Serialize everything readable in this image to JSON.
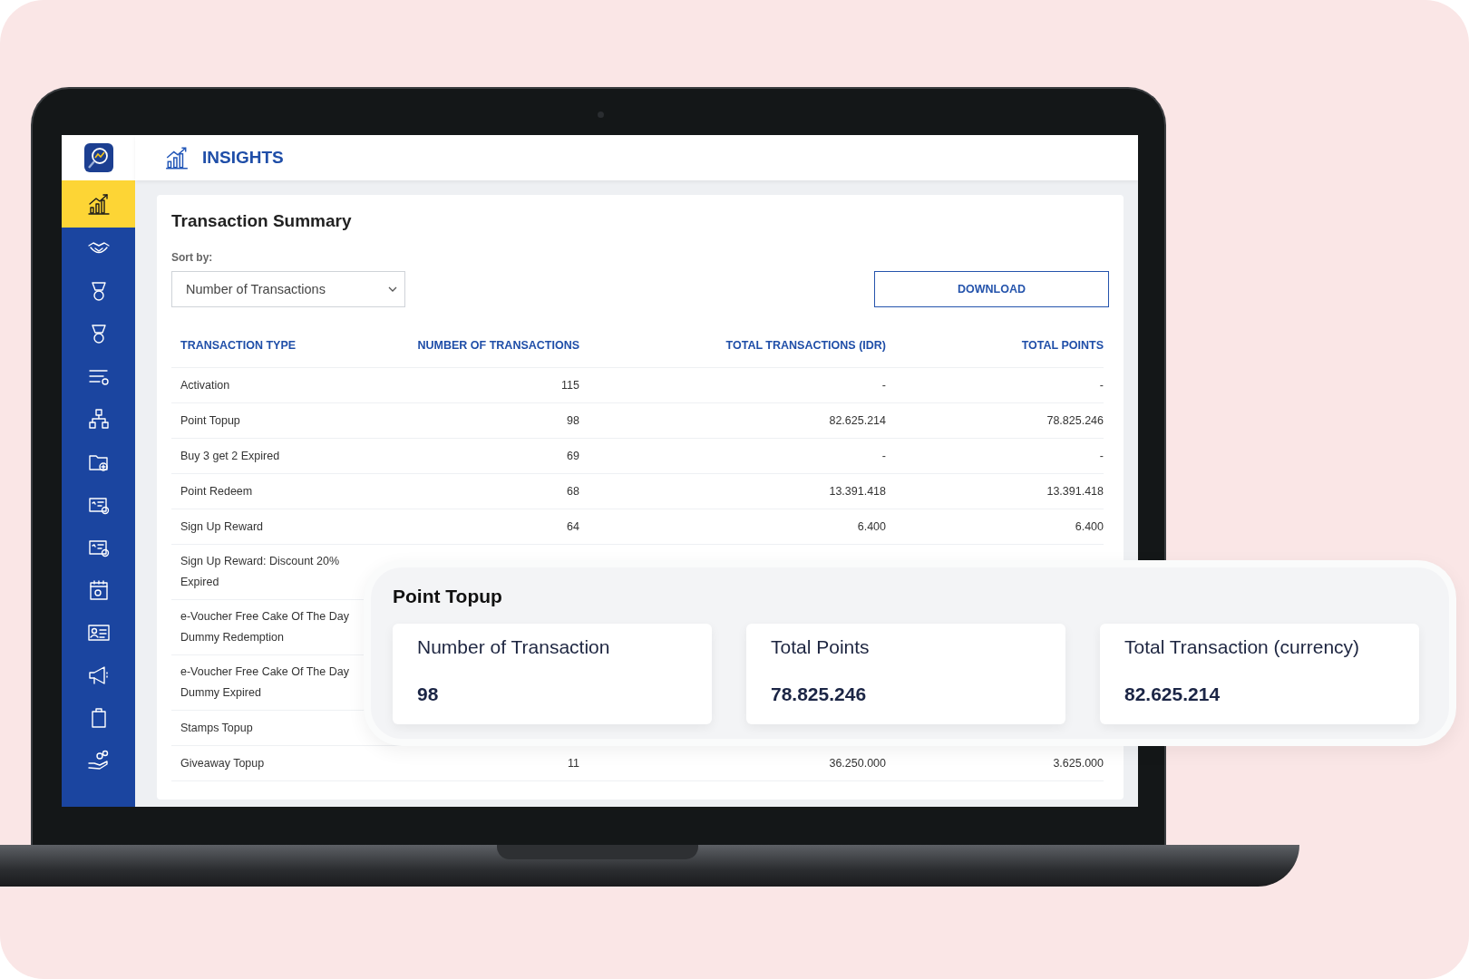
{
  "sidebar": {
    "items": [
      {
        "selected": true
      },
      {
        "selected": false
      },
      {
        "selected": false
      },
      {
        "selected": false
      },
      {
        "selected": false
      },
      {
        "selected": false
      },
      {
        "selected": false
      },
      {
        "selected": false
      },
      {
        "selected": false
      },
      {
        "selected": false
      },
      {
        "selected": false
      },
      {
        "selected": false
      },
      {
        "selected": false
      },
      {
        "selected": false
      }
    ]
  },
  "header": {
    "title": "INSIGHTS"
  },
  "summary": {
    "title": "Transaction Summary",
    "sort_label": "Sort by:",
    "sort_value": "Number of Transactions",
    "download": "DOWNLOAD"
  },
  "table": {
    "columns": [
      "TRANSACTION TYPE",
      "NUMBER OF TRANSACTIONS",
      "TOTAL TRANSACTIONS (IDR)",
      "TOTAL POINTS"
    ],
    "rows": [
      {
        "cells": [
          "Activation",
          "115",
          "-",
          "-"
        ]
      },
      {
        "cells": [
          "Point Topup",
          "98",
          "82.625.214",
          "78.825.246"
        ]
      },
      {
        "cells": [
          "Buy 3 get 2 Expired",
          "69",
          "-",
          "-"
        ]
      },
      {
        "cells": [
          "Point Redeem",
          "68",
          "13.391.418",
          "13.391.418"
        ]
      },
      {
        "cells": [
          "Sign Up Reward",
          "64",
          "6.400",
          "6.400"
        ]
      },
      {
        "cells": [
          "Sign Up Reward: Discount 20% Expired"
        ]
      },
      {
        "cells": [
          "e-Voucher Free Cake Of The Day Dummy Redemption"
        ]
      },
      {
        "cells": [
          "e-Voucher Free Cake Of The Day Dummy Expired"
        ]
      },
      {
        "cells": [
          "Stamps Topup"
        ]
      },
      {
        "cells": [
          "Giveaway Topup",
          "11",
          "36.250.000",
          "3.625.000"
        ]
      }
    ]
  },
  "detail": {
    "title": "Point Topup",
    "stats": [
      {
        "label": "Number of Transaction",
        "value": "98"
      },
      {
        "label": "Total Points",
        "value": "78.825.246"
      },
      {
        "label": "Total Transaction (currency)",
        "value": "82.625.214"
      }
    ]
  }
}
